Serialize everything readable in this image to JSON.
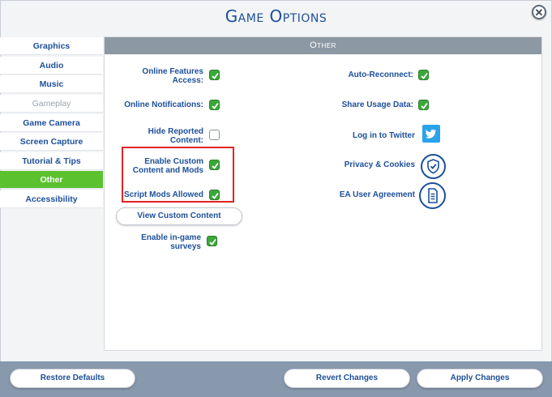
{
  "dialog": {
    "title": "Game Options",
    "close_icon": "close-icon"
  },
  "sidebar": {
    "items": [
      {
        "label": "Graphics",
        "state": "normal"
      },
      {
        "label": "Audio",
        "state": "normal"
      },
      {
        "label": "Music",
        "state": "normal"
      },
      {
        "label": "Gameplay",
        "state": "disabled"
      },
      {
        "label": "Game Camera",
        "state": "normal"
      },
      {
        "label": "Screen Capture",
        "state": "normal"
      },
      {
        "label": "Tutorial & Tips",
        "state": "normal"
      },
      {
        "label": "Other",
        "state": "active"
      },
      {
        "label": "Accessibility",
        "state": "normal"
      }
    ]
  },
  "panel": {
    "header": "Other",
    "left": {
      "online_features": {
        "label": "Online Features Access:",
        "checked": true
      },
      "online_notifications": {
        "label": "Online Notifications:",
        "checked": true
      },
      "hide_reported": {
        "label": "Hide Reported Content:",
        "checked": false
      },
      "enable_custom": {
        "label": "Enable Custom Content and Mods",
        "checked": true
      },
      "script_mods": {
        "label": "Script Mods Allowed",
        "checked": true
      },
      "view_custom_button": "View Custom Content",
      "ingame_surveys": {
        "label": "Enable in-game surveys",
        "checked": true
      }
    },
    "right": {
      "auto_reconnect": {
        "label": "Auto-Reconnect:",
        "checked": true
      },
      "share_usage": {
        "label": "Share Usage Data:",
        "checked": true
      },
      "twitter": {
        "label": "Log in to Twitter",
        "icon": "twitter-icon"
      },
      "privacy": {
        "label": "Privacy & Cookies",
        "icon": "shield-check-icon"
      },
      "ea_agreement": {
        "label": "EA User Agreement",
        "icon": "document-icon"
      }
    }
  },
  "footer": {
    "restore_defaults": "Restore Defaults",
    "revert_changes": "Revert Changes",
    "apply_changes": "Apply Changes"
  },
  "colors": {
    "accent_blue": "#1d4f9a",
    "active_green": "#5cc12e",
    "check_green": "#3ba93a",
    "highlight_red": "#e02424",
    "twitter_blue": "#2aa3ec"
  }
}
